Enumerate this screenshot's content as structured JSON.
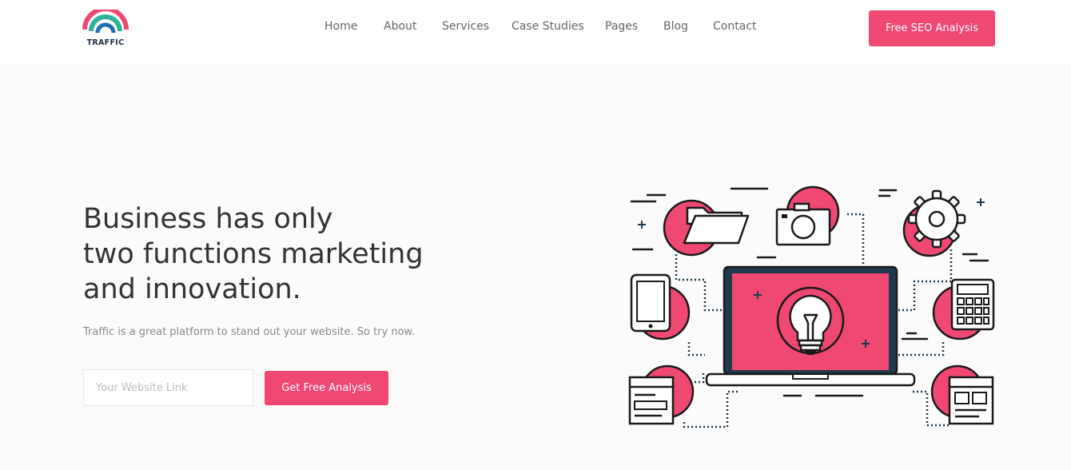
{
  "brand": {
    "name": "TRAFFIC"
  },
  "nav": {
    "items": [
      {
        "label": "Home"
      },
      {
        "label": "About"
      },
      {
        "label": "Services"
      },
      {
        "label": "Case Studies"
      },
      {
        "label": "Pages"
      },
      {
        "label": "Blog"
      },
      {
        "label": "Contact"
      }
    ]
  },
  "header": {
    "cta_label": "Free SEO Analysis"
  },
  "hero": {
    "title_lines": [
      "Business has only",
      "two functions marketing",
      "and innovation."
    ],
    "subtitle": "Traffic is a great platform to stand out your website. So try now.",
    "input_placeholder": "Your Website Link",
    "input_value": "",
    "cta_label": "Get Free Analysis"
  },
  "colors": {
    "accent": "#ef4872",
    "teal": "#2fb39a",
    "dark": "#1a1a1a",
    "text": "#333333"
  },
  "illustration_icons": [
    "laptop-icon",
    "lightbulb-icon",
    "folder-icon",
    "camera-icon",
    "gear-icon",
    "smartphone-icon",
    "calculator-icon",
    "browser-window-icon",
    "layout-window-icon"
  ]
}
